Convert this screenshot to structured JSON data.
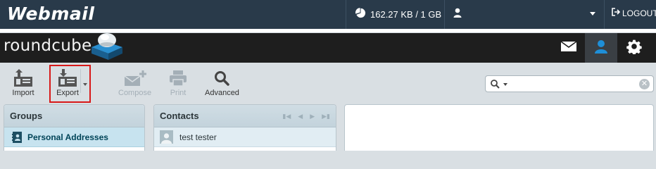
{
  "cpanel": {
    "brand": "Webmail",
    "quota": "162.27 KB / 1 GB",
    "logout": "LOGOUT"
  },
  "roundcube": {
    "brand": "roundcube",
    "nav": [
      {
        "icon": "envelope-icon",
        "active": false
      },
      {
        "icon": "user-icon",
        "active": true
      },
      {
        "icon": "gear-icon",
        "active": false
      }
    ]
  },
  "toolbar": {
    "import": "Import",
    "export": "Export",
    "compose": "Compose",
    "print": "Print",
    "advanced": "Advanced"
  },
  "groups": {
    "title": "Groups",
    "items": [
      {
        "label": "Personal Addresses",
        "selected": true
      }
    ]
  },
  "contacts": {
    "title": "Contacts",
    "items": [
      {
        "name": "test tester"
      }
    ]
  },
  "colors": {
    "cpanel_bar": "#293a4a",
    "rc_header": "#1e1e1e",
    "accent": "#1e8fd8",
    "highlight": "#d81919"
  }
}
